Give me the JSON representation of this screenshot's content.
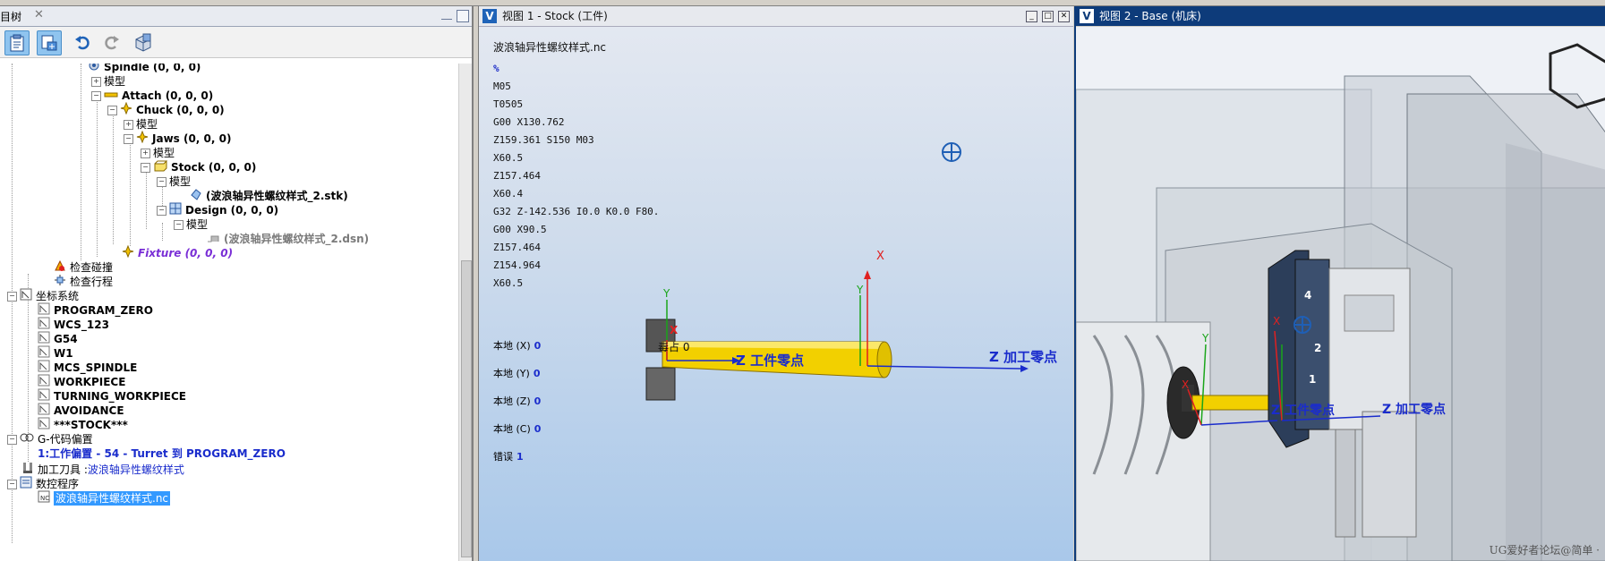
{
  "left_panel": {
    "tab_title": "目树",
    "tree": [
      {
        "label": "Spindle (0, 0, 0)",
        "style": "bold",
        "icon": "spindle-icon"
      },
      {
        "label": "模型",
        "style": "normal",
        "icon": ""
      },
      {
        "label": "Attach (0, 0, 0)",
        "style": "bold",
        "icon": "attach-icon"
      },
      {
        "label": "Chuck (0, 0, 0)",
        "style": "bold",
        "icon": "chuck-icon"
      },
      {
        "label": "模型",
        "style": "normal",
        "icon": ""
      },
      {
        "label": "Jaws (0, 0, 0)",
        "style": "bold",
        "icon": "jaws-icon"
      },
      {
        "label": "模型",
        "style": "normal",
        "icon": ""
      },
      {
        "label": "Stock (0, 0, 0)",
        "style": "bold",
        "icon": "stock-icon"
      },
      {
        "label": "模型",
        "style": "normal",
        "icon": ""
      },
      {
        "label": "(波浪轴异性螺纹样式_2.stk)",
        "style": "bold",
        "icon": "stk-file-icon"
      },
      {
        "label": "Design (0, 0, 0)",
        "style": "bold",
        "icon": "design-icon"
      },
      {
        "label": "模型",
        "style": "normal",
        "icon": ""
      },
      {
        "label": "(波浪轴异性螺纹样式_2.dsn)",
        "style": "grey",
        "icon": "dsn-file-icon"
      },
      {
        "label": "Fixture (0, 0, 0)",
        "style": "fixture",
        "icon": "fixture-icon"
      },
      {
        "label": "检查碰撞",
        "style": "normal",
        "icon": "collision-check-icon"
      },
      {
        "label": "检查行程",
        "style": "normal",
        "icon": "travel-check-icon"
      },
      {
        "label": "坐标系统",
        "style": "normal",
        "icon": "coordinate-system-icon"
      },
      {
        "label": "PROGRAM_ZERO",
        "style": "bold",
        "icon": "csys-icon"
      },
      {
        "label": "WCS_123",
        "style": "bold",
        "icon": "csys-icon"
      },
      {
        "label": "G54",
        "style": "bold",
        "icon": "csys-icon"
      },
      {
        "label": "W1",
        "style": "bold",
        "icon": "csys-icon"
      },
      {
        "label": "MCS_SPINDLE",
        "style": "bold",
        "icon": "csys-icon"
      },
      {
        "label": "WORKPIECE",
        "style": "bold",
        "icon": "csys-icon"
      },
      {
        "label": "TURNING_WORKPIECE",
        "style": "bold",
        "icon": "csys-icon"
      },
      {
        "label": "AVOIDANCE",
        "style": "bold",
        "icon": "csys-icon"
      },
      {
        "label": "***STOCK***",
        "style": "bold",
        "icon": "csys-icon"
      },
      {
        "label": "G-代码偏置",
        "style": "normal",
        "icon": "gcode-offset-icon"
      },
      {
        "label": "1:工作偏置 - 54 - Turret 到 PROGRAM_ZERO",
        "style": "blue",
        "icon": ""
      },
      {
        "label": "加工刀具 : ",
        "label2": "波浪轴异性螺纹样式",
        "style": "tool",
        "icon": "tool-icon"
      },
      {
        "label": "数控程序",
        "style": "normal",
        "icon": "nc-program-icon"
      },
      {
        "label": "波浪轴异性螺纹样式.nc",
        "style": "selected",
        "icon": "nc-file-icon"
      }
    ]
  },
  "view1": {
    "title": "视图 1 - Stock (工件)",
    "nc_file": "波浪轴异性螺纹样式.nc",
    "nc_lines": [
      "%",
      "M05",
      "T0505",
      "G00 X130.762",
      "Z159.361 S150 M03",
      "X60.5",
      "Z157.464",
      "X60.4",
      "G32 Z-142.536 I0.0 K0.0 F80.",
      "G00 X90.5",
      "Z157.464",
      "Z154.964",
      "X60.5"
    ],
    "local": [
      {
        "label": "本地 (X)",
        "value": "0"
      },
      {
        "label": "本地 (Y)",
        "value": "0"
      },
      {
        "label": "本地 (Z)",
        "value": "0"
      },
      {
        "label": "本地 (C)",
        "value": "0"
      }
    ],
    "error_label": "错误",
    "error_value": "1",
    "scene": {
      "label_y": "Y",
      "label_x": "X",
      "partial_text": "毒占 0",
      "workpiece_zero": "Z 工件零点",
      "machining_zero": "Z 加工零点"
    }
  },
  "view2": {
    "title": "视图 2 - Base (机床)",
    "scene": {
      "label_y": "Y",
      "label_x": "X",
      "workpiece_zero": "Z 工件零点",
      "machining_zero": "Z 加工零点",
      "turret_numbers": [
        "4",
        "2",
        "1"
      ]
    },
    "watermark": "UG爱好者论坛@简单 ·"
  },
  "colors": {
    "stock_yellow": "#f2d000",
    "axis_green": "#1aa51a",
    "axis_red": "#e02020",
    "axis_blue": "#1a2ccc",
    "selection": "#3399ff",
    "title_active": "#0d3b7a"
  }
}
